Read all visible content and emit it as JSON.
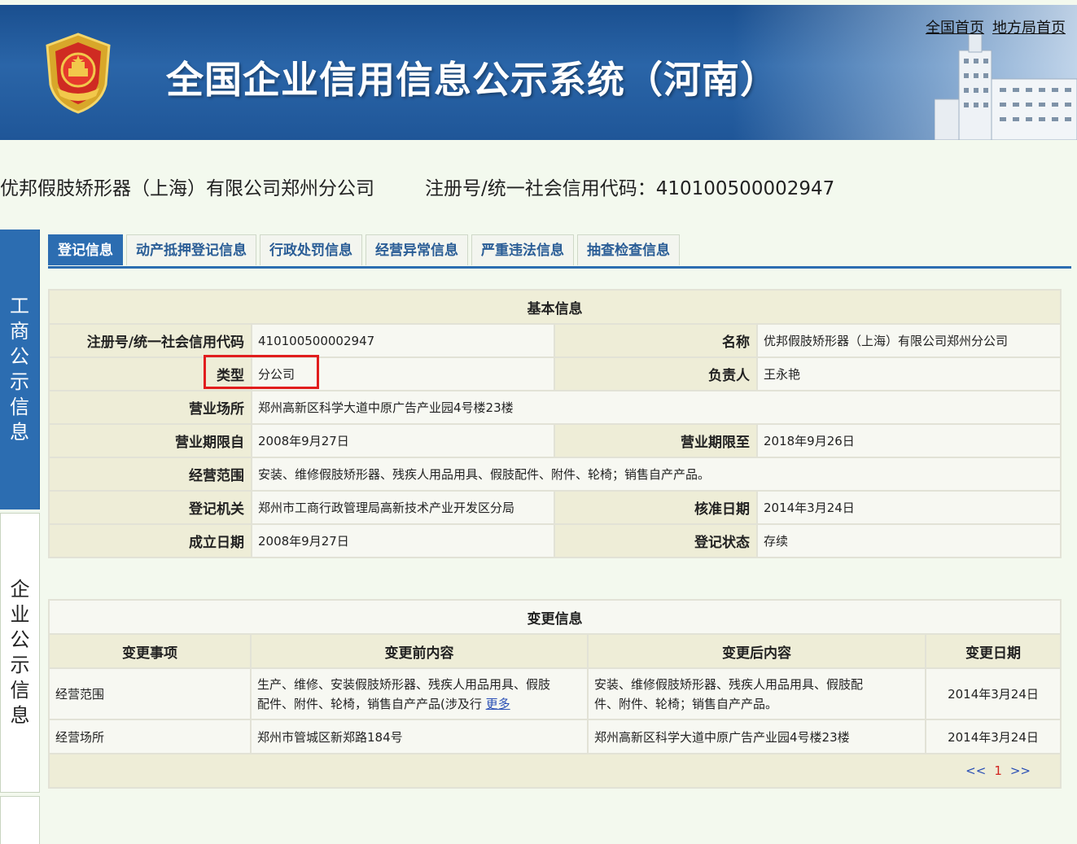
{
  "header": {
    "site_title": "全国企业信用信息公示系统（河南）",
    "links": {
      "national_home": "全国首页",
      "local_home": "地方局首页"
    }
  },
  "company": {
    "name": "优邦假肢矫形器（上海）有限公司郑州分公司",
    "code_line": "注册号/统一社会信用代码：410100500002947"
  },
  "side_tabs": {
    "gongshang": [
      "工",
      "商",
      "公",
      "示",
      "信",
      "息"
    ],
    "qiye": [
      "企",
      "业",
      "公",
      "示",
      "信",
      "息"
    ]
  },
  "tabs": [
    "登记信息",
    "动产抵押登记信息",
    "行政处罚信息",
    "经营异常信息",
    "严重违法信息",
    "抽查检查信息"
  ],
  "basic": {
    "caption": "基本信息",
    "reg_label": "注册号/统一社会信用代码",
    "reg_value": "410100500002947",
    "name_label": "名称",
    "name_value": "优邦假肢矫形器（上海）有限公司郑州分公司",
    "type_label": "类型",
    "type_value": "分公司",
    "owner_label": "负责人",
    "owner_value": "王永艳",
    "address_label": "营业场所",
    "address_value": "郑州高新区科学大道中原广告产业园4号楼23楼",
    "from_label": "营业期限自",
    "from_value": "2008年9月27日",
    "to_label": "营业期限至",
    "to_value": "2018年9月26日",
    "scope_label": "经营范围",
    "scope_value": "安装、维修假肢矫形器、残疾人用品用具、假肢配件、附件、轮椅；销售自产产品。",
    "authority_label": "登记机关",
    "authority_value": "郑州市工商行政管理局高新技术产业开发区分局",
    "approval_label": "核准日期",
    "approval_value": "2014年3月24日",
    "founded_label": "成立日期",
    "founded_value": "2008年9月27日",
    "status_label": "登记状态",
    "status_value": "存续"
  },
  "change": {
    "caption": "变更信息",
    "headers": [
      "变更事项",
      "变更前内容",
      "变更后内容",
      "变更日期"
    ],
    "rows": [
      {
        "item": "经营范围",
        "before_l1": "生产、维修、安装假肢矫形器、残疾人用品用具、假肢",
        "before_l2": "配件、附件、轮椅，销售自产产品(涉及行 ",
        "more": "更多",
        "after_l1": "安装、维修假肢矫形器、残疾人用品用具、假肢配",
        "after_l2": "件、附件、轮椅；销售自产产品。",
        "date": "2014年3月24日"
      },
      {
        "item": "经营场所",
        "before": "郑州市管城区新郑路184号",
        "after": "郑州高新区科学大道中原广告产业园4号楼23楼",
        "date": "2014年3月24日"
      }
    ],
    "pager": {
      "prev": "<<",
      "current": "1",
      "next": ">>"
    }
  }
}
